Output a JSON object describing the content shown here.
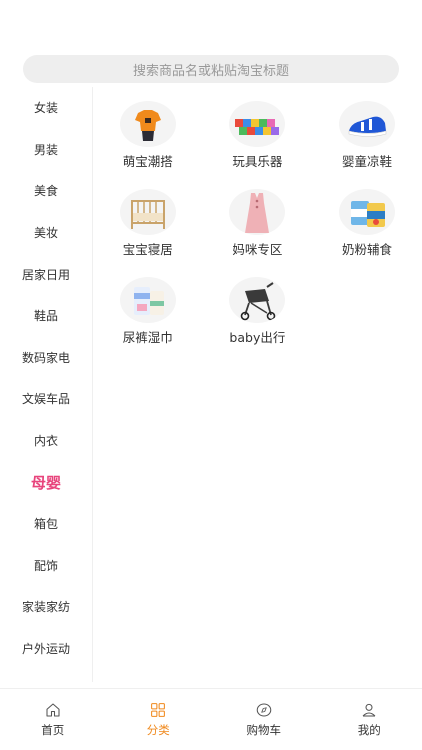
{
  "search": {
    "placeholder": "搜索商品名或粘贴淘宝标题"
  },
  "sidebar": {
    "active_index": 9,
    "items": [
      {
        "label": "女装"
      },
      {
        "label": "男装"
      },
      {
        "label": "美食"
      },
      {
        "label": "美妆"
      },
      {
        "label": "居家日用"
      },
      {
        "label": "鞋品"
      },
      {
        "label": "数码家电"
      },
      {
        "label": "文娱车品"
      },
      {
        "label": "内衣"
      },
      {
        "label": "母婴"
      },
      {
        "label": "箱包"
      },
      {
        "label": "配饰"
      },
      {
        "label": "家装家纺"
      },
      {
        "label": "户外运动"
      }
    ]
  },
  "categories": [
    {
      "label": "萌宝潮搭",
      "icon": "baby-clothes-icon"
    },
    {
      "label": "玩具乐器",
      "icon": "toy-blocks-icon"
    },
    {
      "label": "婴童凉鞋",
      "icon": "sandal-icon"
    },
    {
      "label": "宝宝寝居",
      "icon": "crib-icon"
    },
    {
      "label": "妈咪专区",
      "icon": "maternity-dress-icon"
    },
    {
      "label": "奶粉辅食",
      "icon": "formula-can-icon"
    },
    {
      "label": "尿裤湿巾",
      "icon": "diaper-pack-icon"
    },
    {
      "label": "baby出行",
      "icon": "stroller-icon"
    }
  ],
  "tabbar": {
    "active_index": 1,
    "items": [
      {
        "label": "首页",
        "icon": "home-icon"
      },
      {
        "label": "分类",
        "icon": "category-grid-icon"
      },
      {
        "label": "购物车",
        "icon": "compass-cart-icon"
      },
      {
        "label": "我的",
        "icon": "user-icon"
      }
    ]
  },
  "colors": {
    "accent_pink": "#e8447c",
    "accent_orange": "#f0891d"
  }
}
